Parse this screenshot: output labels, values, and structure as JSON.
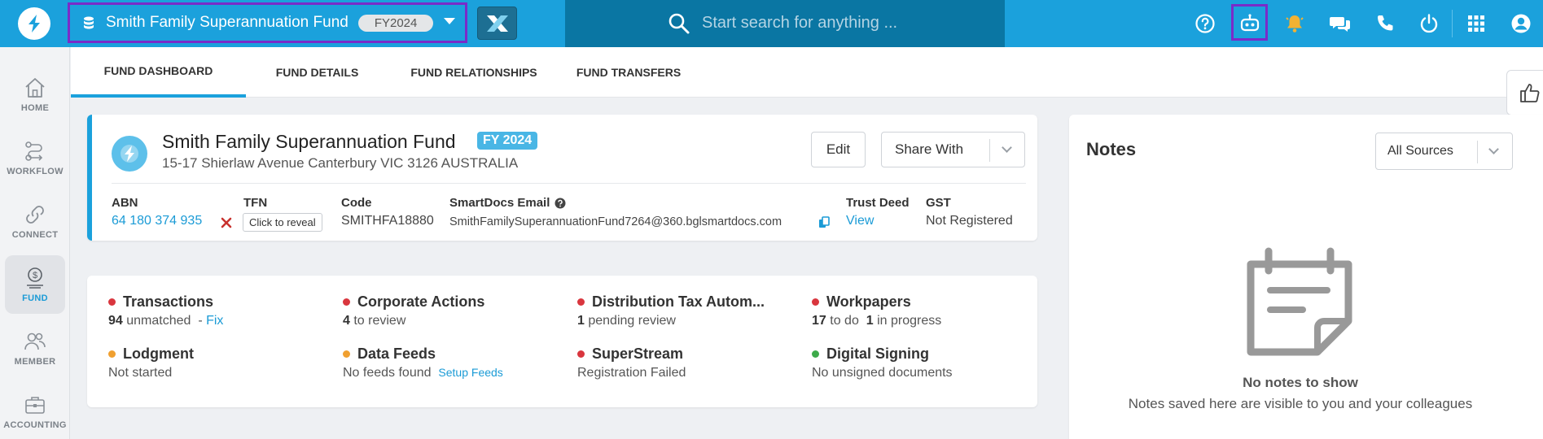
{
  "topbar": {
    "fund_name": "Smith Family Superannuation Fund",
    "fund_year": "FY2024",
    "search_placeholder": "Start search for anything ..."
  },
  "nav": {
    "items": [
      {
        "label": "HOME",
        "icon": "home-icon"
      },
      {
        "label": "WORKFLOW",
        "icon": "workflow-icon"
      },
      {
        "label": "CONNECT",
        "icon": "link-icon"
      },
      {
        "label": "FUND",
        "icon": "fund-icon"
      },
      {
        "label": "MEMBER",
        "icon": "members-icon"
      },
      {
        "label": "ACCOUNTING",
        "icon": "briefcase-icon"
      }
    ]
  },
  "tabs": [
    {
      "label": "FUND DASHBOARD"
    },
    {
      "label": "FUND DETAILS"
    },
    {
      "label": "FUND RELATIONSHIPS"
    },
    {
      "label": "FUND TRANSFERS"
    }
  ],
  "fund": {
    "name": "Smith Family Superannuation Fund",
    "fy_badge": "FY 2024",
    "address": "15-17 Shierlaw Avenue Canterbury VIC 3126 AUSTRALIA",
    "edit_label": "Edit",
    "share_label": "Share With",
    "abn_label": "ABN",
    "abn_value": "64 180 374 935",
    "tfn_label": "TFN",
    "tfn_reveal": "Click to reveal",
    "code_label": "Code",
    "code_value": "SMITHFA18880",
    "email_label": "SmartDocs Email",
    "email_value": "SmithFamilySuperannuationFund7264@360.bglsmartdocs.com",
    "trust_label": "Trust Deed",
    "trust_value": "View",
    "gst_label": "GST",
    "gst_value": "Not Registered"
  },
  "status": {
    "transactions": {
      "title": "Transactions",
      "count": "94",
      "text": "unmatched",
      "sep": "-",
      "link": "Fix"
    },
    "corporate": {
      "title": "Corporate Actions",
      "count": "4",
      "text": "to review"
    },
    "distribution": {
      "title": "Distribution Tax Autom...",
      "count": "1",
      "text": "pending review"
    },
    "workpapers": {
      "title": "Workpapers",
      "count1": "17",
      "text1": "to do",
      "count2": "1",
      "text2": "in progress"
    },
    "lodgment": {
      "title": "Lodgment",
      "text": "Not started"
    },
    "datafeeds": {
      "title": "Data Feeds",
      "text": "No feeds found",
      "link": "Setup Feeds"
    },
    "superstream": {
      "title": "SuperStream",
      "text": "Registration Failed"
    },
    "signing": {
      "title": "Digital Signing",
      "text": "No unsigned documents"
    }
  },
  "colors": {
    "red": "#d9363e",
    "orange": "#f0a030",
    "green": "#3daa4a",
    "accent": "#1ba1dc"
  },
  "notes": {
    "title": "Notes",
    "sources": "All Sources",
    "empty_title": "No notes to show",
    "empty_sub": "Notes saved here are visible to you and your colleagues"
  }
}
